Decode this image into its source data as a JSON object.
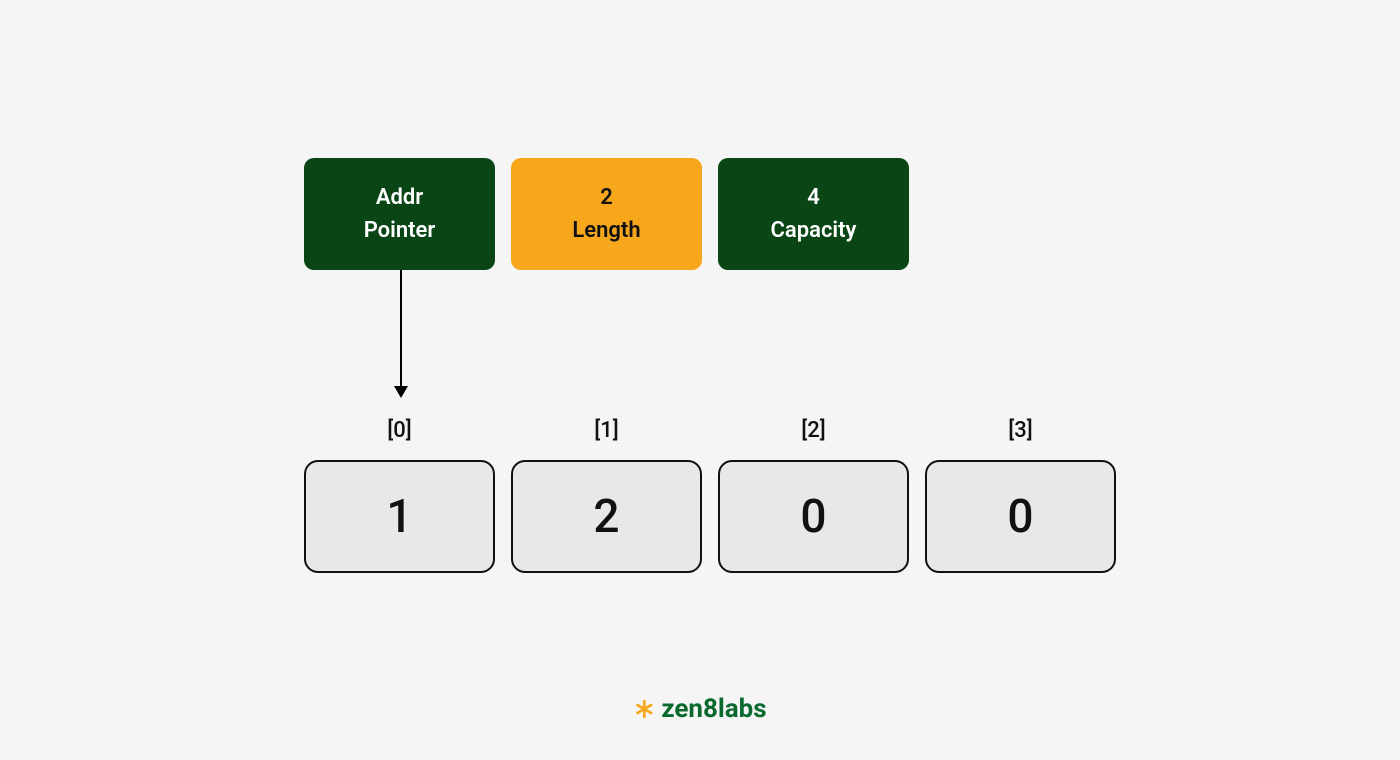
{
  "header": {
    "cards": [
      {
        "value": "Addr",
        "label": "Pointer",
        "style": "green"
      },
      {
        "value": "2",
        "label": "Length",
        "style": "orange"
      },
      {
        "value": "4",
        "label": "Capacity",
        "style": "green"
      }
    ]
  },
  "array": {
    "index_labels": [
      "[0]",
      "[1]",
      "[2]",
      "[3]"
    ],
    "values": [
      "1",
      "2",
      "0",
      "0"
    ]
  },
  "brand": {
    "name": "zen8labs",
    "icon_color": "#f7a71c",
    "text_color": "#0a6a2e"
  },
  "colors": {
    "background": "#f5f5f5",
    "card_green": "#0a4516",
    "card_orange": "#f7a71c",
    "cell_bg": "#e8e8e8",
    "cell_border": "#111111"
  }
}
